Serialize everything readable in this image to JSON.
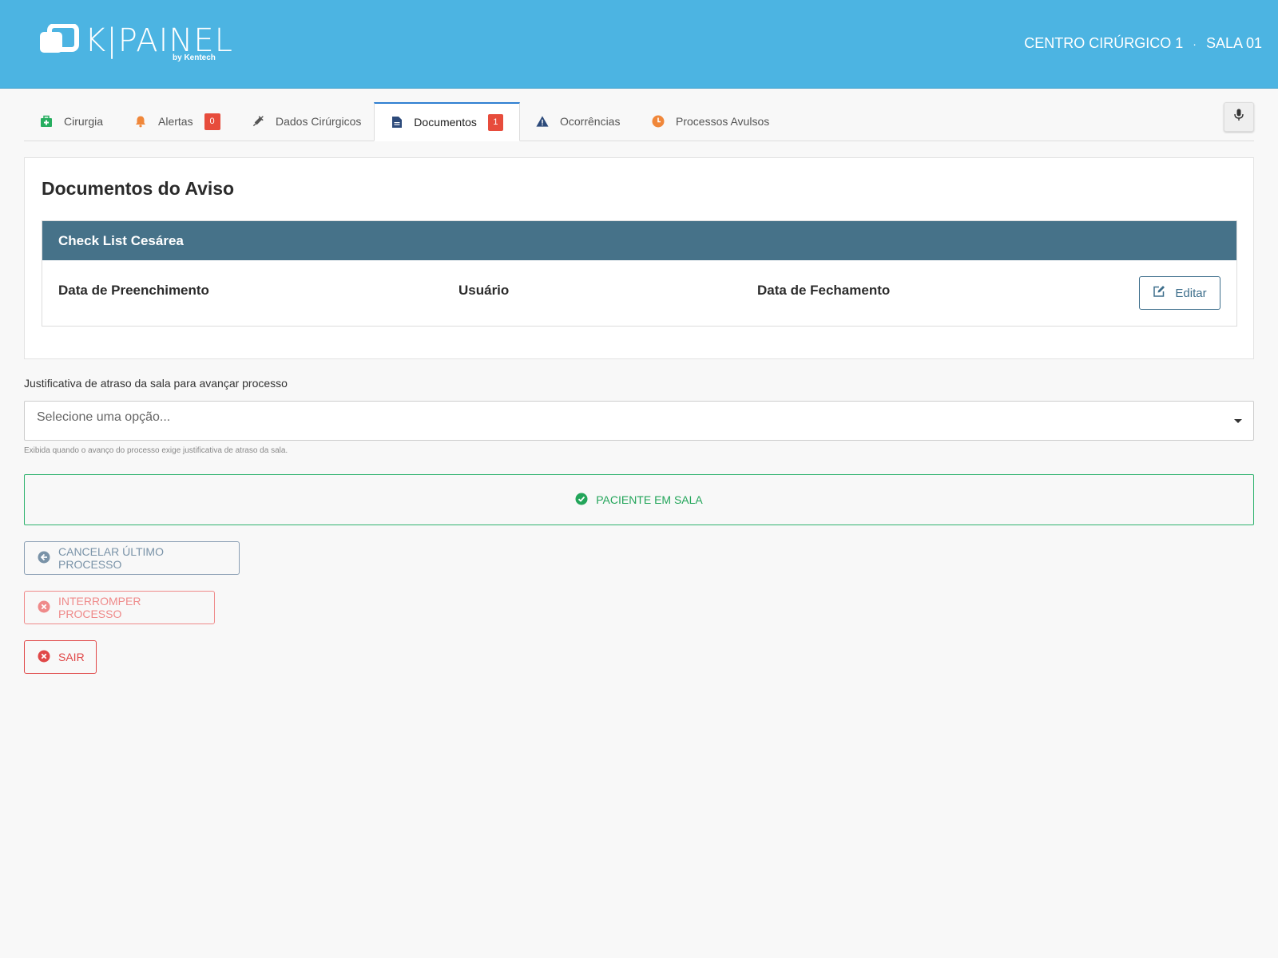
{
  "header": {
    "logo_text": "K|PAINEL",
    "logo_sub": "by Kentech",
    "location": "CENTRO CIRÚRGICO 1",
    "separator": "·",
    "room": "SALA 01",
    "bg_color": "#4cb4e2"
  },
  "tabs": [
    {
      "label": "Cirurgia",
      "icon": "medkit-icon"
    },
    {
      "label": "Alertas",
      "icon": "bell-icon",
      "badge": "0"
    },
    {
      "label": "Dados Cirúrgicos",
      "icon": "syringe-icon"
    },
    {
      "label": "Documentos",
      "icon": "document-icon",
      "badge": "1",
      "active": true
    },
    {
      "label": "Ocorrências",
      "icon": "warning-icon"
    },
    {
      "label": "Processos Avulsos",
      "icon": "clock-icon"
    }
  ],
  "mic_button": {
    "icon": "microphone-icon"
  },
  "documents": {
    "title": "Documentos do Aviso",
    "checklist_title": "Check List Cesárea",
    "columns": [
      "Data de Preenchimento",
      "Usuário",
      "Data de Fechamento"
    ],
    "edit_label": "Editar"
  },
  "justification": {
    "label": "Justificativa de atraso da sala para avançar processo",
    "placeholder": "Selecione uma opção...",
    "help": "Exibida quando o avanço do processo exige justificativa de atraso da sala."
  },
  "status": {
    "label": "PACIENTE EM SALA",
    "color": "#23a55a"
  },
  "actions": {
    "cancel_label": "CANCELAR ÚLTIMO PROCESSO",
    "interrupt_label": "INTERROMPER PROCESSO",
    "exit_label": "SAIR"
  }
}
